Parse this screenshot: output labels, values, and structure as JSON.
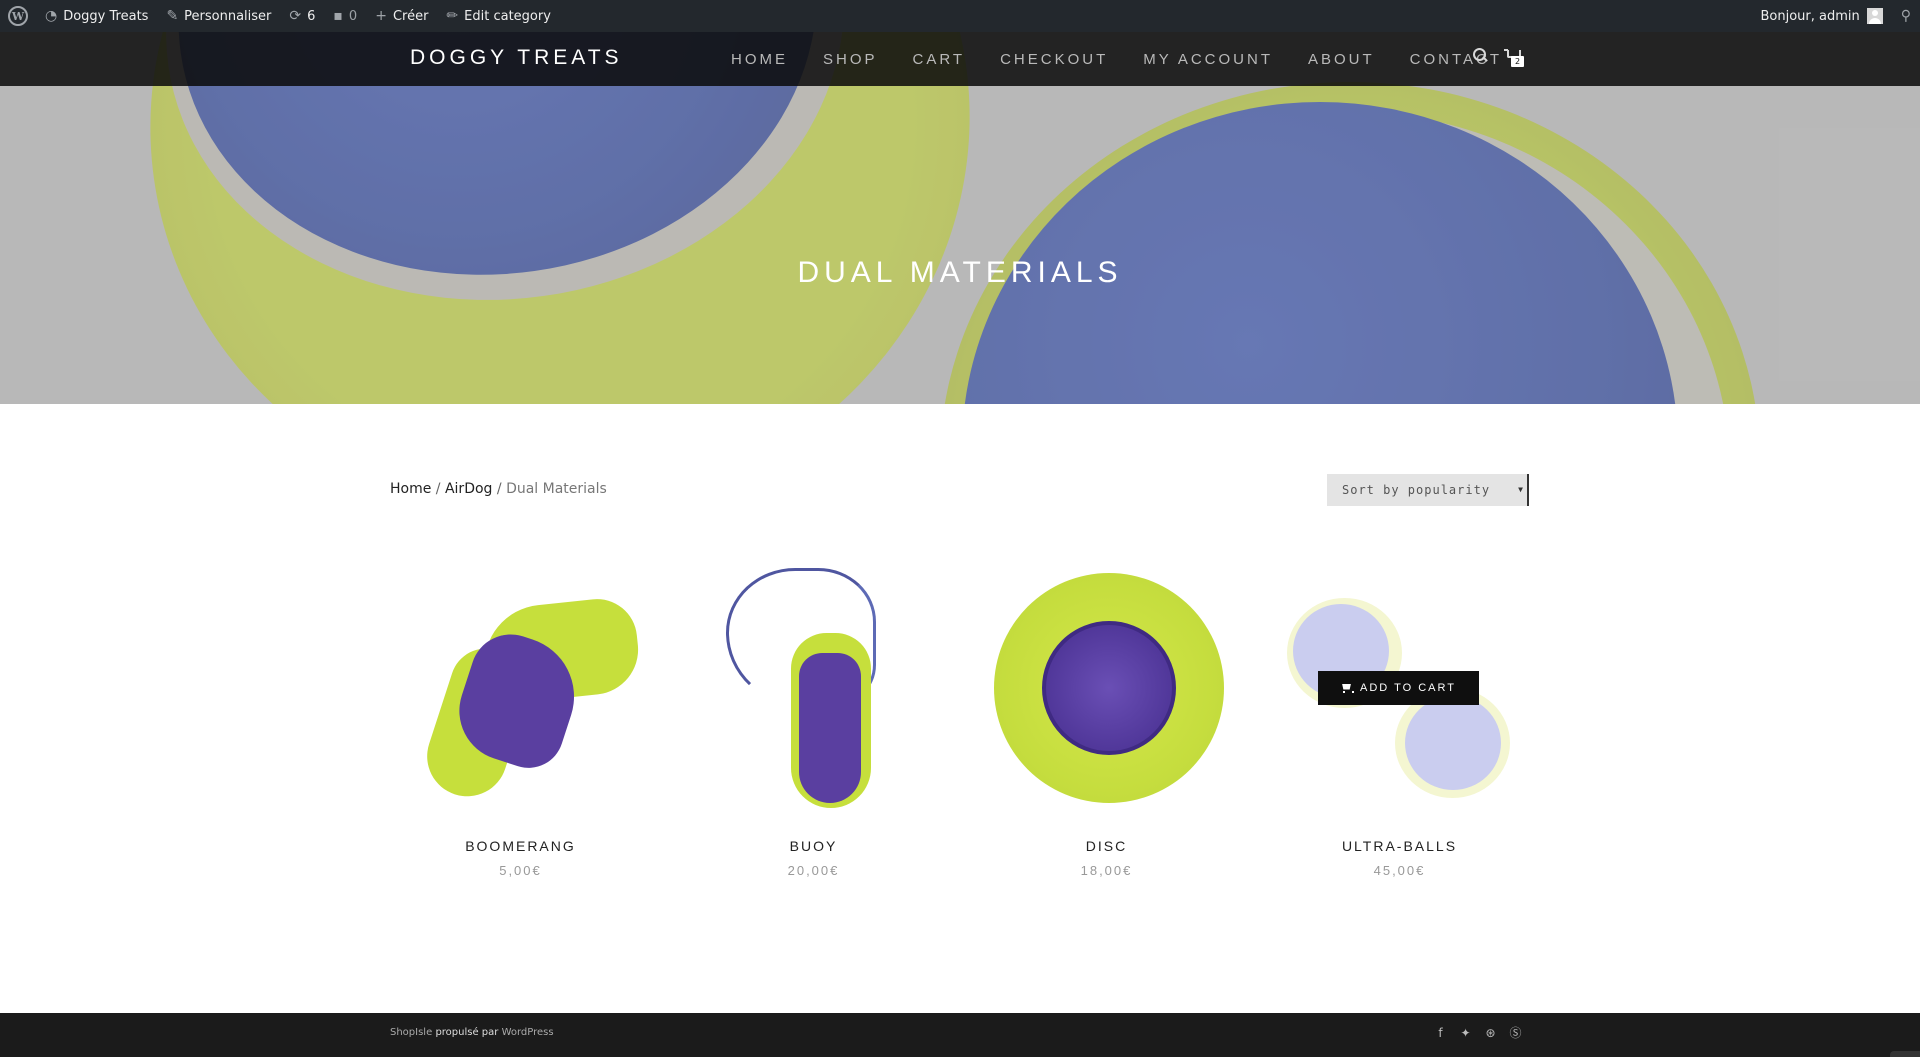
{
  "admin_bar": {
    "site_name": "Doggy Treats",
    "customize": "Personnaliser",
    "updates_count": "6",
    "comments_count": "0",
    "new": "Créer",
    "edit": "Edit category",
    "greeting": "Bonjour, admin"
  },
  "header": {
    "brand": "DOGGY TREATS",
    "nav": [
      "HOME",
      "SHOP",
      "CART",
      "CHECKOUT",
      "MY ACCOUNT",
      "ABOUT",
      "CONTACT"
    ],
    "cart_count": "2"
  },
  "hero": {
    "title": "DUAL MATERIALS"
  },
  "breadcrumb": {
    "home": "Home",
    "sep1": "/",
    "parent": "AirDog",
    "sep2": "/",
    "current": "Dual Materials"
  },
  "sort": {
    "selected": "Sort by popularity"
  },
  "products": [
    {
      "name": "BOOMERANG",
      "price": "5,00€"
    },
    {
      "name": "BUOY",
      "price": "20,00€"
    },
    {
      "name": "DISC",
      "price": "18,00€"
    },
    {
      "name": "ULTRA-BALLS",
      "price": "45,00€"
    }
  ],
  "add_to_cart": "ADD TO CART",
  "footer": {
    "brand_link": "ShopIsle",
    "powered": "propulsé par",
    "wp_link": "WordPress",
    "social": [
      "facebook-icon",
      "twitter-icon",
      "dribbble-icon",
      "skype-icon"
    ]
  }
}
